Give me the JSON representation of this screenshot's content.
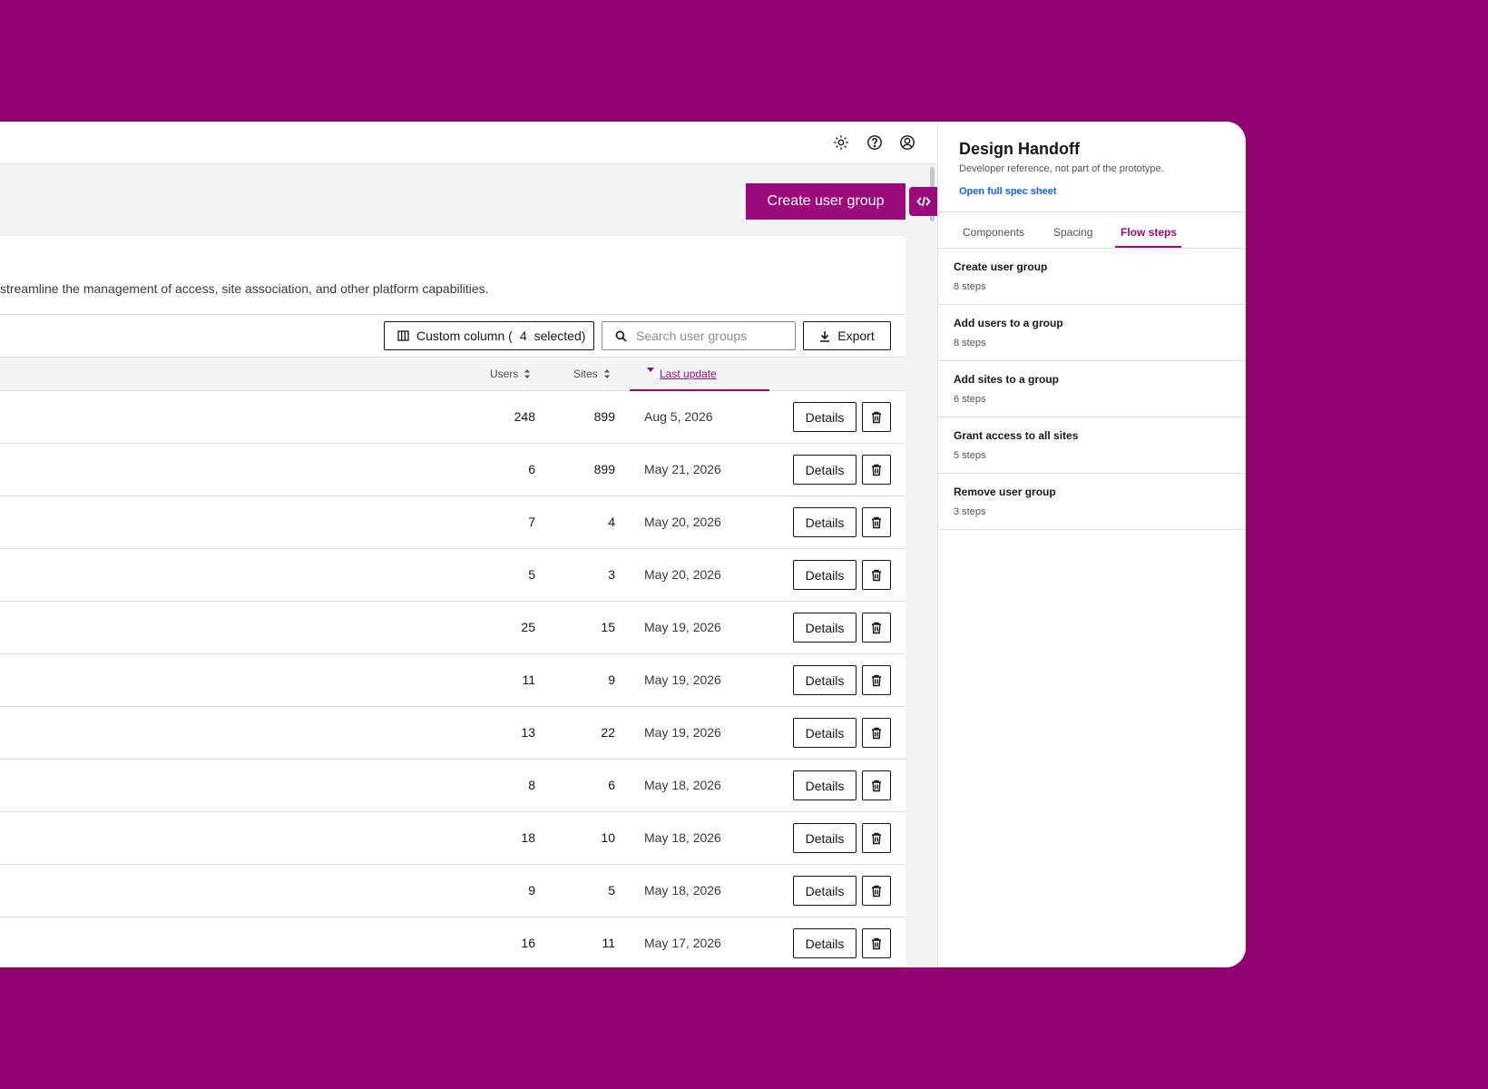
{
  "toolbar": {
    "create_label": "Create user group",
    "description": "streamline the management of access, site association, and other platform capabilities.",
    "custom_column_prefix": "Custom column (",
    "custom_column_count": "4",
    "custom_column_suffix": "selected)",
    "search_placeholder": "Search user groups",
    "export_label": "Export"
  },
  "table": {
    "headers": {
      "users": "Users",
      "sites": "Sites",
      "last_update": "Last update"
    },
    "action_label": "Details",
    "rows": [
      {
        "users": "248",
        "sites": "899",
        "date": "Aug 5, 2026"
      },
      {
        "users": "6",
        "sites": "899",
        "date": "May 21, 2026"
      },
      {
        "users": "7",
        "sites": "4",
        "date": "May 20, 2026"
      },
      {
        "users": "5",
        "sites": "3",
        "date": "May 20, 2026"
      },
      {
        "users": "25",
        "sites": "15",
        "date": "May 19, 2026"
      },
      {
        "users": "11",
        "sites": "9",
        "date": "May 19, 2026"
      },
      {
        "users": "13",
        "sites": "22",
        "date": "May 19, 2026"
      },
      {
        "users": "8",
        "sites": "6",
        "date": "May 18, 2026"
      },
      {
        "users": "18",
        "sites": "10",
        "date": "May 18, 2026"
      },
      {
        "users": "9",
        "sites": "5",
        "date": "May 18, 2026"
      },
      {
        "users": "16",
        "sites": "11",
        "date": "May 17, 2026"
      }
    ]
  },
  "panel": {
    "title": "Design Handoff",
    "subtitle": "Developer reference, not part of the prototype.",
    "link": "Open full spec sheet",
    "tabs": [
      "Components",
      "Spacing",
      "Flow steps"
    ],
    "active_tab": "Flow steps",
    "flows": [
      {
        "name": "Create user group",
        "steps": "8 steps"
      },
      {
        "name": "Add users to a group",
        "steps": "8 steps"
      },
      {
        "name": "Add sites to a group",
        "steps": "6 steps"
      },
      {
        "name": "Grant access to all sites",
        "steps": "5 steps"
      },
      {
        "name": "Remove user group",
        "steps": "3 steps"
      }
    ]
  },
  "colors": {
    "background": "#910071",
    "accent": "#9b0a7b",
    "link": "#0f62fe"
  },
  "icons": [
    "settings-icon",
    "help-icon",
    "user-profile-icon",
    "code-icon",
    "column-icon",
    "search-icon",
    "download-icon",
    "sort-icon",
    "trash-icon"
  ]
}
